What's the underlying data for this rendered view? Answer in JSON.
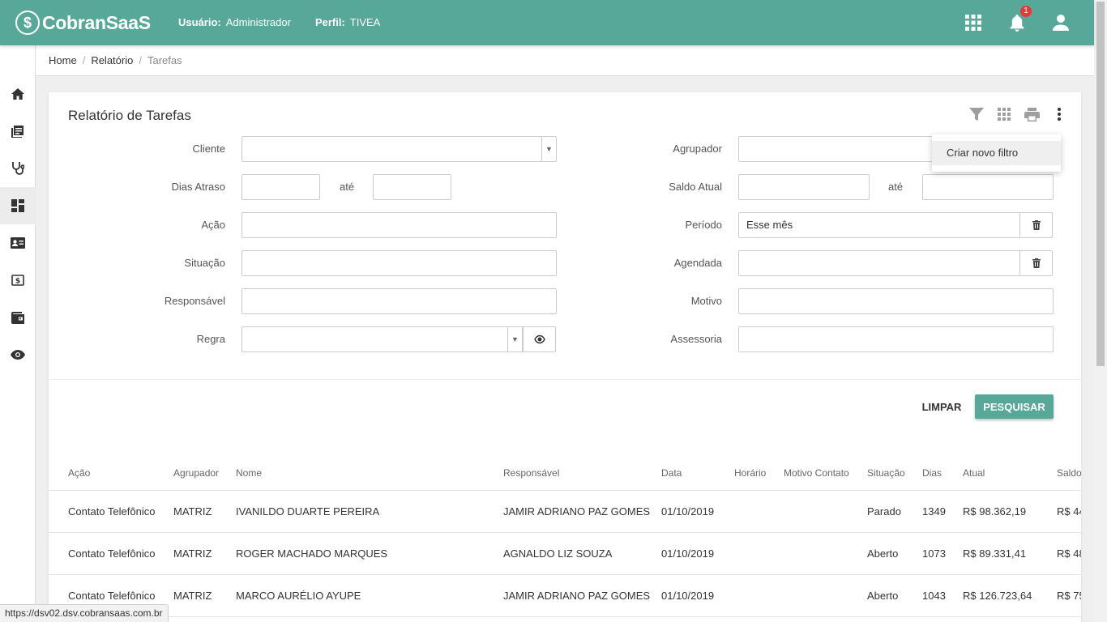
{
  "app": {
    "logo_mark": "$",
    "logo_text": "CobranSaaS"
  },
  "header": {
    "user_label": "Usuário:",
    "user_value": "Administrador",
    "profile_label": "Perfil:",
    "profile_value": "TIVEA",
    "notifications_count": "1",
    "icons": [
      "apps-grid-icon",
      "bell-icon",
      "user-icon"
    ]
  },
  "sidebar": {
    "items": [
      "home-icon",
      "book-icon",
      "stethoscope-icon",
      "dashboard-icon",
      "contact-card-icon",
      "money-icon",
      "wallet-icon",
      "eye-icon"
    ],
    "active_index": 3
  },
  "breadcrumb": {
    "items": [
      "Home",
      "Relatório",
      "Tarefas"
    ]
  },
  "page": {
    "title": "Relatório de Tarefas"
  },
  "tools": [
    "filter-icon",
    "grid-icon",
    "print-icon",
    "more-vert-icon"
  ],
  "menu": {
    "items": [
      "Criar novo filtro"
    ]
  },
  "filters": {
    "cliente": {
      "label": "Cliente",
      "value": ""
    },
    "dias_atraso": {
      "label": "Dias Atraso",
      "from": "",
      "to": ""
    },
    "acao": {
      "label": "Ação",
      "value": ""
    },
    "situacao": {
      "label": "Situação",
      "value": ""
    },
    "responsavel": {
      "label": "Responsável",
      "value": ""
    },
    "regra": {
      "label": "Regra",
      "value": ""
    },
    "agrupador": {
      "label": "Agrupador",
      "value": ""
    },
    "saldo_atual": {
      "label": "Saldo Atual",
      "from": "",
      "to": ""
    },
    "periodo": {
      "label": "Período",
      "value": "Esse mês"
    },
    "agendada": {
      "label": "Agendada",
      "value": ""
    },
    "motivo": {
      "label": "Motivo",
      "value": ""
    },
    "assessoria": {
      "label": "Assessoria",
      "value": ""
    },
    "ate": "até"
  },
  "buttons": {
    "clear": "LIMPAR",
    "search": "PESQUISAR"
  },
  "table": {
    "columns": [
      "Ação",
      "Agrupador",
      "Nome",
      "Responsável",
      "Data",
      "Horário",
      "Motivo Contato",
      "Situação",
      "Dias",
      "Atual",
      "Saldo"
    ],
    "rows": [
      {
        "acao": "Contato Telefônico",
        "agrupador": "MATRIZ",
        "nome": "IVANILDO DUARTE PEREIRA",
        "responsavel": "JAMIR ADRIANO PAZ GOMES",
        "data": "01/10/2019",
        "horario": "",
        "motivo": "",
        "situacao": "Parado",
        "dias": "1349",
        "atual": "R$ 98.362,19",
        "saldo": "R$ 44"
      },
      {
        "acao": "Contato Telefônico",
        "agrupador": "MATRIZ",
        "nome": "ROGER MACHADO MARQUES",
        "responsavel": "AGNALDO LIZ SOUZA",
        "data": "01/10/2019",
        "horario": "",
        "motivo": "",
        "situacao": "Aberto",
        "dias": "1073",
        "atual": "R$ 89.331,41",
        "saldo": "R$ 48"
      },
      {
        "acao": "Contato Telefônico",
        "agrupador": "MATRIZ",
        "nome": "MARCO AURÉLIO AYUPE",
        "responsavel": "JAMIR ADRIANO PAZ GOMES",
        "data": "01/10/2019",
        "horario": "",
        "motivo": "",
        "situacao": "Aberto",
        "dias": "1043",
        "atual": "R$ 126.723,64",
        "saldo": "R$ 75"
      }
    ]
  },
  "statusbar": {
    "url": "https://dsv02.dsv.cobransaas.com.br"
  },
  "colors": {
    "primary": "#57a899",
    "badge": "#e53935"
  }
}
